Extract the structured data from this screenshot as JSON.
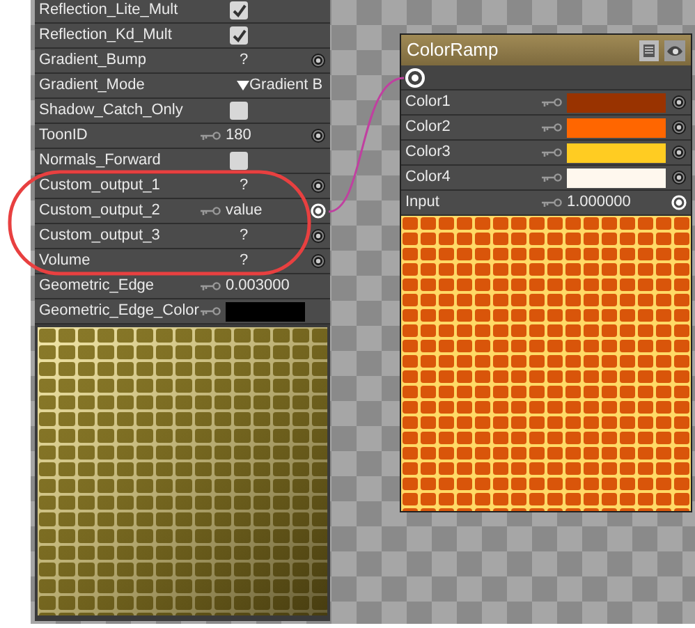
{
  "properties": [
    {
      "label": "Reflection_Lite_Mult",
      "kind": "check",
      "checked": true
    },
    {
      "label": "Reflection_Kd_Mult",
      "kind": "check",
      "checked": true
    },
    {
      "label": "Gradient_Bump",
      "kind": "text",
      "value": "?",
      "connected": false
    },
    {
      "label": "Gradient_Mode",
      "kind": "dropdown",
      "value": "Gradient B"
    },
    {
      "label": "Shadow_Catch_Only",
      "kind": "check",
      "checked": false
    },
    {
      "label": "ToonID",
      "kind": "text",
      "key": true,
      "value": "180",
      "connected": false
    },
    {
      "label": "Normals_Forward",
      "kind": "check",
      "checked": false
    },
    {
      "label": "Custom_output_1",
      "kind": "text",
      "value": "?",
      "connected": false
    },
    {
      "label": "Custom_output_2",
      "kind": "text",
      "key": true,
      "value": "value",
      "connected": true
    },
    {
      "label": "Custom_output_3",
      "kind": "text",
      "value": "?",
      "connected": false
    },
    {
      "label": "Volume",
      "kind": "text",
      "value": "?",
      "connected": false
    },
    {
      "label": "Geometric_Edge",
      "kind": "text",
      "key": true,
      "value": "0.003000"
    },
    {
      "label": "Geometric_Edge_Color",
      "kind": "color",
      "key": true,
      "color": "#000000"
    }
  ],
  "node": {
    "title": "ColorRamp",
    "inputs": [
      {
        "label": "Color1",
        "kind": "color",
        "key": true,
        "color": "#993300",
        "connected": false
      },
      {
        "label": "Color2",
        "kind": "color",
        "key": true,
        "color": "#ff6600",
        "connected": false
      },
      {
        "label": "Color3",
        "kind": "color",
        "key": true,
        "color": "#ffcc22",
        "connected": false
      },
      {
        "label": "Color4",
        "kind": "color",
        "key": true,
        "color": "#fff8ee",
        "connected": false
      },
      {
        "label": "Input",
        "kind": "text",
        "key": true,
        "value": "1.000000",
        "connected": true
      }
    ]
  }
}
